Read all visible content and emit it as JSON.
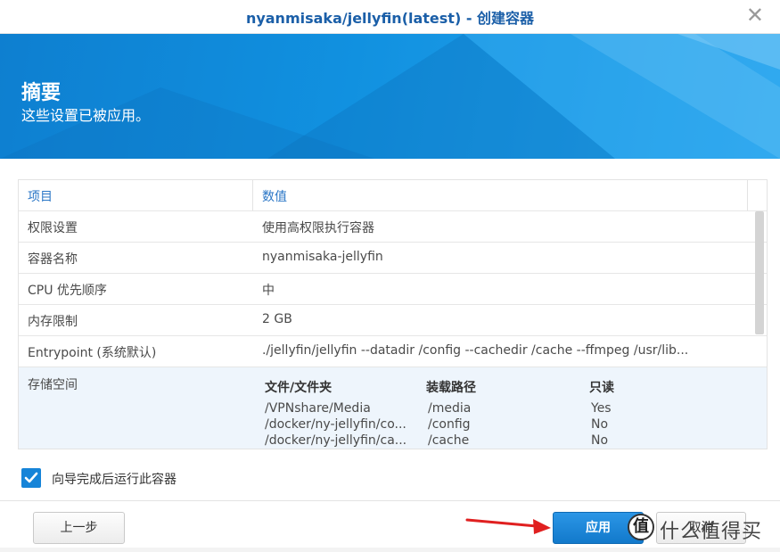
{
  "window": {
    "title": "nyanmisaka/jellyfin(latest) - 创建容器",
    "close_symbol": "✕"
  },
  "banner": {
    "heading": "摘要",
    "subtitle": "这些设置已被应用。"
  },
  "summary_table": {
    "headers": {
      "item": "项目",
      "value": "数值"
    },
    "rows": [
      {
        "item": "权限设置",
        "value": "使用高权限执行容器"
      },
      {
        "item": "容器名称",
        "value": "nyanmisaka-jellyfin"
      },
      {
        "item": "CPU 优先顺序",
        "value": "中"
      },
      {
        "item": "内存限制",
        "value": "2 GB"
      },
      {
        "item": "Entrypoint (系统默认)",
        "value": "./jellyfin/jellyfin --datadir /config --cachedir /cache --ffmpeg /usr/lib..."
      }
    ],
    "storage": {
      "label": "存储空间",
      "columns": [
        "文件/文件夹",
        "装载路径",
        "只读"
      ],
      "mounts": [
        {
          "folder": "/VPNshare/Media",
          "mount": "/media",
          "readonly": "Yes"
        },
        {
          "folder": "/docker/ny-jellyfin/co...",
          "mount": "/config",
          "readonly": "No"
        },
        {
          "folder": "/docker/ny-jellyfin/ca...",
          "mount": "/cache",
          "readonly": "No"
        }
      ]
    }
  },
  "run_after_wizard": {
    "checked": true,
    "label": "向导完成后运行此容器"
  },
  "buttons": {
    "back": "上一步",
    "apply": "应用",
    "cancel": "取消"
  },
  "watermark": {
    "badge": "值",
    "text": "什么值得买"
  },
  "colors": {
    "accent": "#1684d8",
    "title": "#1b5fa8",
    "header_text": "#2a76c6",
    "annotation_arrow": "#e02020"
  }
}
